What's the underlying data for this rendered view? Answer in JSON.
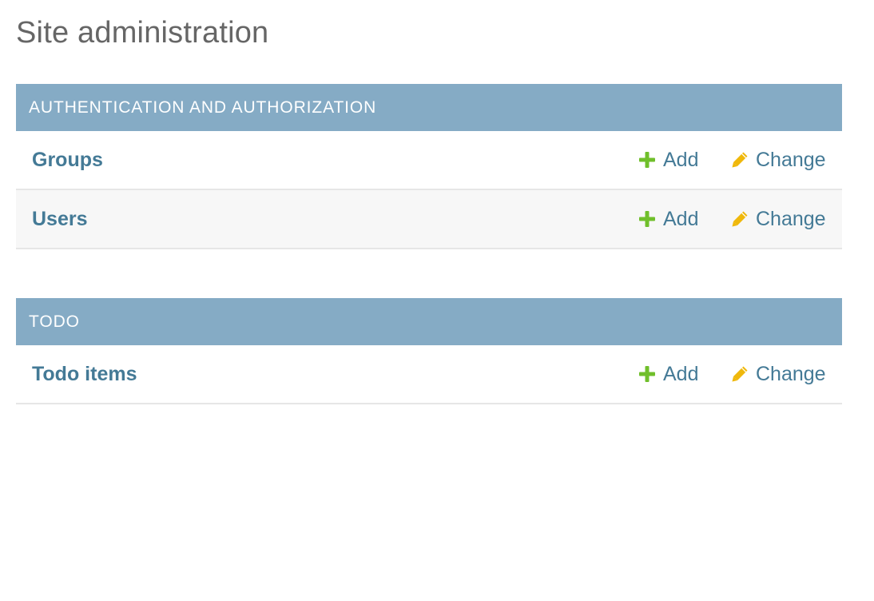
{
  "page": {
    "title": "Site administration"
  },
  "modules": [
    {
      "caption": "AUTHENTICATION AND AUTHORIZATION",
      "rows": [
        {
          "name": "Groups",
          "add_label": "Add",
          "change_label": "Change"
        },
        {
          "name": "Users",
          "add_label": "Add",
          "change_label": "Change"
        }
      ]
    },
    {
      "caption": "TODO",
      "rows": [
        {
          "name": "Todo items",
          "add_label": "Add",
          "change_label": "Change"
        }
      ]
    }
  ],
  "icons": {
    "add": "plus-icon",
    "change": "pencil-icon"
  },
  "colors": {
    "caption_bg": "#85abc5",
    "link": "#447a96",
    "add_icon": "#70bf2b",
    "change_icon": "#efb80b",
    "title": "#666666"
  }
}
